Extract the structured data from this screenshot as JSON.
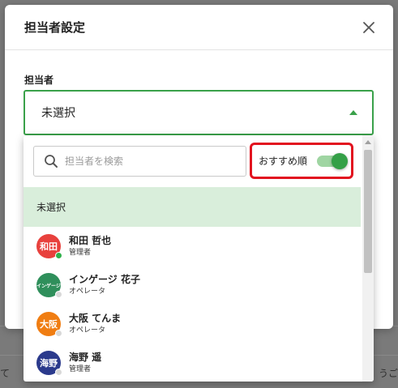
{
  "modal": {
    "title": "担当者設定",
    "field_label": "担当者",
    "selected_value": "未選択"
  },
  "dropdown": {
    "search_placeholder": "担当者を検索",
    "recommended_label": "おすすめ順",
    "recommended_toggle_on": true,
    "unselected_option": "未選択",
    "users": [
      {
        "avatar": "和田",
        "name": "和田 哲也",
        "role": "管理者",
        "avatar_color": "#e8413d",
        "status_color": "#2fb14b"
      },
      {
        "avatar": "インゲージ",
        "name": "インゲージ 花子",
        "role": "オペレータ",
        "avatar_color": "#2f8f5b",
        "status_color": "#d8d8d8"
      },
      {
        "avatar": "大阪",
        "name": "大阪 てんま",
        "role": "オペレータ",
        "avatar_color": "#f07d12",
        "status_color": "#d8d8d8"
      },
      {
        "avatar": "海野",
        "name": "海野 遥",
        "role": "管理者",
        "avatar_color": "#2b3a8c",
        "status_color": "#d8d8d8"
      }
    ]
  },
  "background": {
    "snippet_left": "て",
    "snippet_right": "うご"
  },
  "colors": {
    "accent_green": "#3aa14a",
    "highlight_red": "#e2121f",
    "selected_row_bg": "#d9eedb"
  }
}
